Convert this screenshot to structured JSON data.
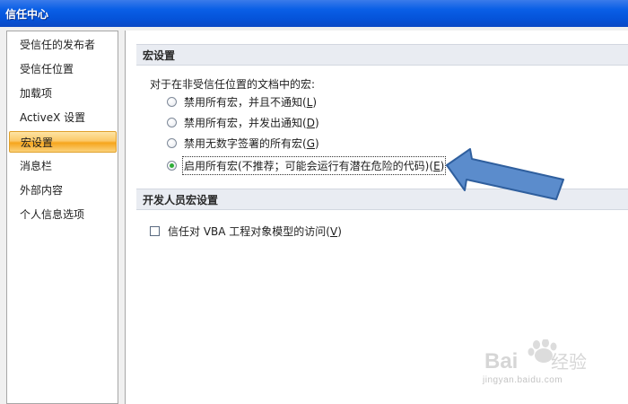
{
  "window": {
    "title": "信任中心"
  },
  "sidebar": {
    "items": [
      {
        "label": "受信任的发布者"
      },
      {
        "label": "受信任位置"
      },
      {
        "label": "加载项"
      },
      {
        "label": "ActiveX 设置"
      },
      {
        "label": "宏设置",
        "selected": true
      },
      {
        "label": "消息栏"
      },
      {
        "label": "外部内容"
      },
      {
        "label": "个人信息选项"
      }
    ]
  },
  "macro_settings": {
    "header": "宏设置",
    "description": "对于在非受信任位置的文档中的宏:",
    "options": [
      {
        "text": "禁用所有宏，并且不通知(",
        "key": "L",
        "close": ")",
        "checked": false
      },
      {
        "text": "禁用所有宏，并发出通知(",
        "key": "D",
        "close": ")",
        "checked": false
      },
      {
        "text": "禁用无数字签署的所有宏(",
        "key": "G",
        "close": ")",
        "checked": false
      },
      {
        "text": "启用所有宏(不推荐；可能会运行有潜在危险的代码)(",
        "key": "E",
        "close": ")",
        "checked": true
      }
    ]
  },
  "developer_settings": {
    "header": "开发人员宏设置",
    "trust_vba": {
      "text": "信任对 VBA 工程对象模型的访问(",
      "key": "V",
      "close": ")",
      "checked": false
    }
  },
  "watermark": {
    "brand": "Bai",
    "brand2": "经验",
    "url": "jingyan.baidu.com"
  },
  "colors": {
    "titlebar": "#0553d9",
    "selected_nav": "#fbc867",
    "arrow": "#4a7dbf",
    "radio_dot": "#2fae38"
  }
}
